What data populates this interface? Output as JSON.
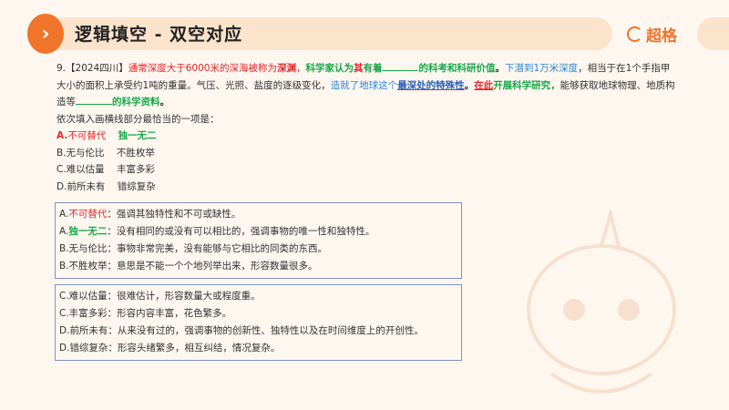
{
  "header": {
    "title": "逻辑填空 - 双空对应",
    "logo": "超格"
  },
  "question": {
    "number": "9.【2024四川】",
    "s1": "通常深度大于6000米的深海被称为",
    "s2": "深渊",
    "s3": "，",
    "s4": "科学家认为",
    "s5": "其",
    "s6": "有着",
    "s7": "的科考和科研价值",
    "s8": "。",
    "s9": "下潜到1万米深度",
    "s10": "，相当于在1个手指甲大小的面积上承受约1吨的重量。气压、光照、盐度的逐级变化，",
    "s11": "造就了地球这个",
    "s12": "最深处的特殊性",
    "s13": "。",
    "s14": "在此",
    "s15": "开展科学研究",
    "s16": "，能够获取地球物理、地质构造等",
    "s17": "的科学资料",
    "s18": "。",
    "prompt": "依次填入画横线部分最恰当的一项是：",
    "options": [
      {
        "letter": "A.",
        "w1": "不可替代",
        "w2": "独一无二"
      },
      {
        "letter": "B.",
        "w1": "无与伦比",
        "w2": "不胜枚举"
      },
      {
        "letter": "C.",
        "w1": "难以估量",
        "w2": "丰富多彩"
      },
      {
        "letter": "D.",
        "w1": "前所未有",
        "w2": "错综复杂"
      }
    ]
  },
  "box1": [
    {
      "prefix": "A.",
      "term": "不可替代",
      "def": "：强调其独特性和不可或缺性。"
    },
    {
      "prefix": "A.",
      "term": "独一无二",
      "def": "：没有相同的或没有可以相比的，强调事物的唯一性和独特性。"
    },
    {
      "prefix": "B.",
      "term": "无与伦比",
      "def": "：事物非常完美，没有能够与它相比的同类的东西。"
    },
    {
      "prefix": "B.",
      "term": "不胜枚举",
      "def": "：意思是不能一个个地列举出来，形容数量很多。"
    }
  ],
  "box2": [
    {
      "prefix": "C.",
      "term": "难以估量",
      "def": "：很难估计，形容数量大或程度重。"
    },
    {
      "prefix": "C.",
      "term": "丰富多彩",
      "def": "：形容内容丰富，花色繁多。"
    },
    {
      "prefix": "D.",
      "term": "前所未有",
      "def": "：从来没有过的，强调事物的创新性、独特性以及在时间维度上的开创性。"
    },
    {
      "prefix": "D.",
      "term": "错综复杂",
      "def": "：形容头绪繁多，相互纠结，情况复杂。"
    }
  ],
  "colors": {
    "accent": "#f0742a",
    "red": "#e8262a",
    "green": "#1aa84a",
    "blue": "#2f86d6"
  }
}
